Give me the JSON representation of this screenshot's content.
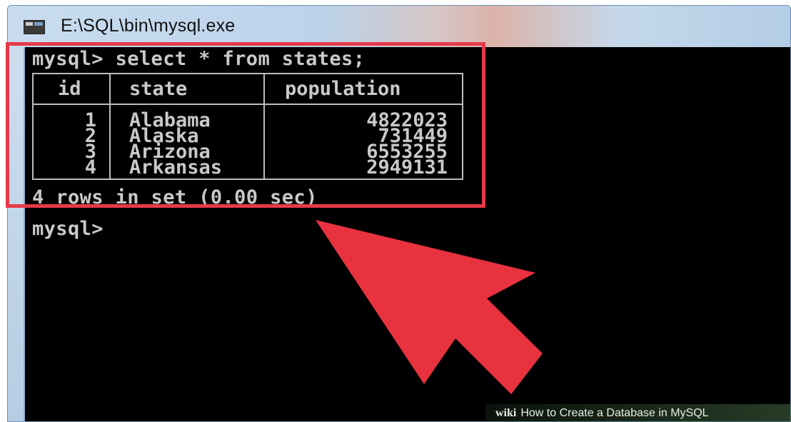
{
  "window": {
    "title": "E:\\SQL\\bin\\mysql.exe"
  },
  "console": {
    "command": "mysql> select * from states;",
    "table": {
      "columns": [
        "id",
        "state",
        "population"
      ],
      "rows": [
        [
          "1",
          "Alabama",
          "4822023"
        ],
        [
          "2",
          "Alaska",
          "731449"
        ],
        [
          "3",
          "Arizona",
          "6553255"
        ],
        [
          "4",
          "Arkansas",
          "2949131"
        ]
      ]
    },
    "result_summary": "4 rows in set (0.00 sec)",
    "prompt": "mysql>"
  },
  "annotation": {
    "highlight_color": "#e53a4a",
    "arrow_color": "#e8323f"
  },
  "watermark": {
    "logo": "wiki",
    "text": "How to Create a Database in MySQL"
  }
}
